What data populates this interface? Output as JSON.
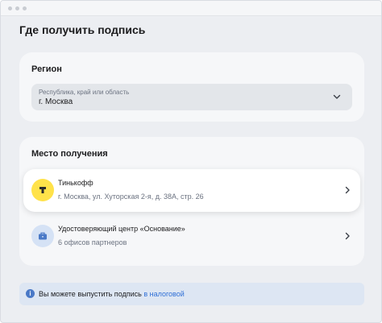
{
  "page": {
    "title": "Где получить подпись"
  },
  "region": {
    "title": "Регион",
    "select": {
      "placeholder": "Республика, край или область",
      "value": "г. Москва"
    }
  },
  "place": {
    "title": "Место получения",
    "options": [
      {
        "name": "Тинькофф",
        "detail": "г. Москва, ул. Хуторская 2-я, д. 38А, стр. 26",
        "icon": "tinkoff-logo-icon",
        "icon_color": "#ffe24a",
        "selected": true
      },
      {
        "name": "Удостоверяющий центр «Основание»",
        "detail": "6 офисов партнеров",
        "icon": "briefcase-icon",
        "icon_color": "#d5e2f5",
        "selected": false
      }
    ]
  },
  "notice": {
    "icon": "info-icon",
    "icon_glyph": "i",
    "text": "Вы можете выпустить подпись ",
    "link": "в налоговой"
  },
  "colors": {
    "accent": "#2f6fd6",
    "background": "#eceef2",
    "card": "#f6f7f9"
  }
}
